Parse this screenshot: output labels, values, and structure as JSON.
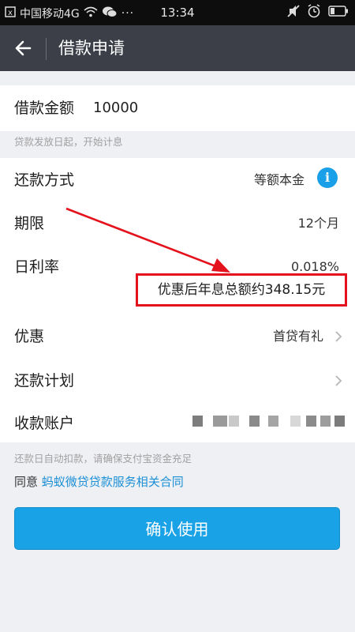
{
  "status_bar": {
    "carrier": "中国移动4G",
    "time": "13:34"
  },
  "header": {
    "title": "借款申请"
  },
  "loan_amount": {
    "label": "借款金额",
    "value": "10000",
    "hint": "贷款发放日起，开始计息"
  },
  "details": {
    "repay_method": {
      "label": "还款方式",
      "value": "等额本金"
    },
    "term": {
      "label": "期限",
      "value": "12个月"
    },
    "daily_rate": {
      "label": "日利率",
      "value": "0.018%"
    },
    "interest_note": "优惠后年息总额约348.15元",
    "discount": {
      "label": "优惠",
      "value": "首贷有礼"
    },
    "repay_plan": {
      "label": "还款计划"
    },
    "account": {
      "label": "收款账户"
    }
  },
  "footer": {
    "hint": "还款日自动扣款，请确保支付宝资金充足",
    "agree_prefix": "同意",
    "agree_link": "蚂蚁微贷贷款服务相关合同",
    "confirm_label": "确认使用"
  },
  "colors": {
    "accent": "#1aa2e6",
    "appbar": "#3c3f48",
    "annotation_red": "#e4121c"
  },
  "icons": [
    "back-arrow-icon",
    "info-icon",
    "chevron-right-icon",
    "wifi-icon",
    "wechat-icon",
    "mute-icon",
    "alarm-icon",
    "battery-icon"
  ]
}
